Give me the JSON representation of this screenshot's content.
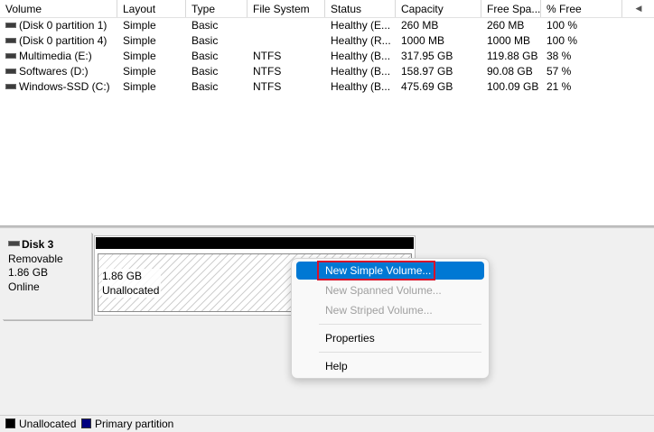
{
  "columns": [
    "Volume",
    "Layout",
    "Type",
    "File System",
    "Status",
    "Capacity",
    "Free Spa...",
    "% Free"
  ],
  "volumes": [
    {
      "volume": "(Disk 0 partition 1)",
      "layout": "Simple",
      "type": "Basic",
      "fs": "",
      "status": "Healthy (E...",
      "capacity": "260 MB",
      "free": "260 MB",
      "pct": "100 %"
    },
    {
      "volume": "(Disk 0 partition 4)",
      "layout": "Simple",
      "type": "Basic",
      "fs": "",
      "status": "Healthy (R...",
      "capacity": "1000 MB",
      "free": "1000 MB",
      "pct": "100 %"
    },
    {
      "volume": "Multimedia (E:)",
      "layout": "Simple",
      "type": "Basic",
      "fs": "NTFS",
      "status": "Healthy (B...",
      "capacity": "317.95 GB",
      "free": "119.88 GB",
      "pct": "38 %"
    },
    {
      "volume": "Softwares (D:)",
      "layout": "Simple",
      "type": "Basic",
      "fs": "NTFS",
      "status": "Healthy (B...",
      "capacity": "158.97 GB",
      "free": "90.08 GB",
      "pct": "57 %"
    },
    {
      "volume": "Windows-SSD (C:)",
      "layout": "Simple",
      "type": "Basic",
      "fs": "NTFS",
      "status": "Healthy (B...",
      "capacity": "475.69 GB",
      "free": "100.09 GB",
      "pct": "21 %"
    }
  ],
  "disk": {
    "title": "Disk 3",
    "kind": "Removable",
    "size": "1.86 GB",
    "state": "Online",
    "partition": {
      "size": "1.86 GB",
      "label": "Unallocated"
    }
  },
  "context_menu": {
    "new_simple": "New Simple Volume...",
    "new_spanned": "New Spanned Volume...",
    "new_striped": "New Striped Volume...",
    "properties": "Properties",
    "help": "Help"
  },
  "legend": {
    "unallocated": "Unallocated",
    "primary": "Primary partition"
  },
  "colors": {
    "unallocated": "#000000",
    "primary": "#00007f",
    "selection": "#0078d4",
    "highlight_box": "#d9102a"
  }
}
